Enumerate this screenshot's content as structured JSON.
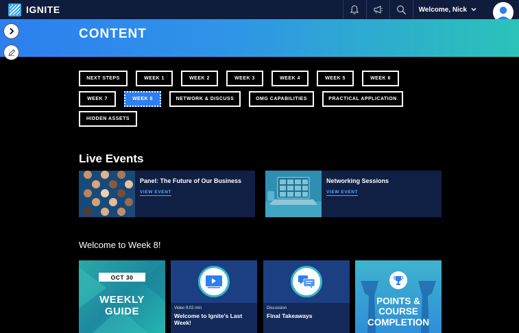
{
  "header": {
    "logo_text": "IGNITE",
    "welcome": "Welcome, Nick",
    "icons": [
      "bell-icon",
      "megaphone-icon",
      "search-icon",
      "chevron-down-icon",
      "avatar"
    ]
  },
  "banner": {
    "title": "CONTENT"
  },
  "side": {
    "icons": [
      "chevron-right-icon",
      "pencil-icon"
    ]
  },
  "weeks": [
    {
      "label": "NEXT STEPS"
    },
    {
      "label": "WEEK 1"
    },
    {
      "label": "WEEK 2"
    },
    {
      "label": "WEEK 3"
    },
    {
      "label": "WEEK 4"
    },
    {
      "label": "WEEK 5"
    },
    {
      "label": "WEEK 6"
    },
    {
      "label": "WEEK 7"
    },
    {
      "label": "WEEK 8",
      "active": true
    },
    {
      "label": "NETWORK & DISCUSS"
    },
    {
      "label": "OMG CAPABILITIES"
    },
    {
      "label": "PRACTICAL APPLICATION"
    },
    {
      "label": "HIDDEN ASSETS"
    }
  ],
  "live_events": {
    "title": "Live Events",
    "items": [
      {
        "title": "Panel: The Future of Our Business",
        "link": "VIEW EVENT"
      },
      {
        "title": "Networking Sessions",
        "link": "VIEW EVENT"
      }
    ]
  },
  "week_section": {
    "title": "Welcome to Week 8!",
    "tiles": [
      {
        "badge": "OCT 30",
        "line1": "WEEKLY",
        "line2": "GUIDE"
      },
      {
        "meta": "Video 9:02 min",
        "title": "Welcome to Ignite's Last Week!"
      },
      {
        "meta": "Discussion",
        "title": "Final Takeaways"
      },
      {
        "line1": "POINTS &",
        "line2": "COURSE",
        "line3": "COMPLETION"
      }
    ]
  },
  "colors": {
    "topbar": "#0f1c3c",
    "accent": "#2d7ff0",
    "card": "#101f44",
    "link": "#59a8ff"
  }
}
